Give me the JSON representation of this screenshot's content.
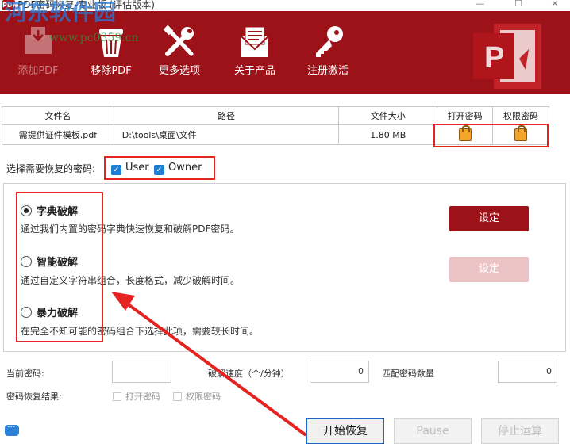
{
  "window": {
    "title": "PDF密码恢复-专业版 (评估版本)",
    "app_icon_text": "PDF",
    "watermark": "河东软件园",
    "watermark_url": "www.pc0359.cn",
    "minimize": "—",
    "maximize": "☐",
    "close": "✕"
  },
  "colors": {
    "brand": "#9c1218",
    "accent_blue": "#1d7fd6",
    "highlight_red": "#e52421",
    "lock": "#f3a52b"
  },
  "toolbar": {
    "items": [
      {
        "label": "添加PDF",
        "icon": "folder-add-icon",
        "enabled": false
      },
      {
        "label": "移除PDF",
        "icon": "trash-icon",
        "enabled": true
      },
      {
        "label": "更多选项",
        "icon": "tools-icon",
        "enabled": true
      },
      {
        "label": "关于产品",
        "icon": "envelope-icon",
        "enabled": true
      },
      {
        "label": "注册激活",
        "icon": "key-icon",
        "enabled": true
      }
    ],
    "logo_icon": "powerpoint-logo-icon"
  },
  "file_table": {
    "headers": [
      "文件名",
      "路径",
      "文件大小",
      "打开密码",
      "权限密码"
    ],
    "rows": [
      {
        "name": "需提供证件模板.pdf",
        "path": "D:\\tools\\桌面\\文件",
        "size": "1.80 MB",
        "open_icon": "lock-icon",
        "perm_icon": "lock-icon"
      }
    ]
  },
  "password_type": {
    "label": "选择需要恢复的密码:",
    "user": {
      "label": "User",
      "checked": true
    },
    "owner": {
      "label": "Owner",
      "checked": true
    }
  },
  "methods": [
    {
      "title": "字典破解",
      "desc": "通过我们内置的密码字典快速恢复和破解PDF密码。",
      "selected": true,
      "button": "设定",
      "button_enabled": true
    },
    {
      "title": "智能破解",
      "desc": "通过自定义字符串组合，长度格式，减少破解时间。",
      "selected": false,
      "button": "设定",
      "button_enabled": false
    },
    {
      "title": "暴力破解",
      "desc": "在完全不知可能的密码组合下选择此项，需要较长时间。",
      "selected": false
    }
  ],
  "status": {
    "current_password_label": "当前密码:",
    "current_password_value": "",
    "speed_label": "破解速度（个/分钟）",
    "speed_value": "0",
    "match_count_label": "匹配密码数量",
    "match_count_value": "0",
    "result_label": "密码恢复结果:",
    "result_open": "打开密码",
    "result_perm": "权限密码"
  },
  "buttons": {
    "start": "开始恢复",
    "pause": "Pause",
    "stop": "停止运算"
  },
  "chat_icon": "chat-bubble-icon"
}
